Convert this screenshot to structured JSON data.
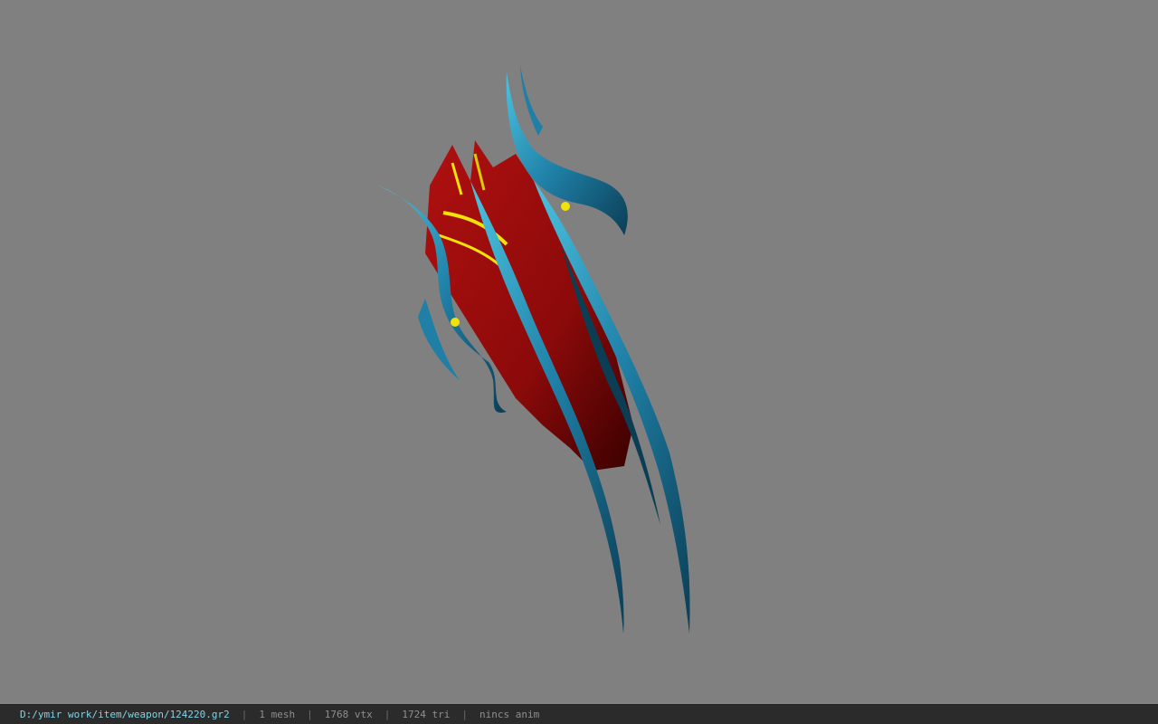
{
  "viewer": {
    "background_color": "#808080",
    "model": {
      "icon": "3d-model-weapon",
      "colors": {
        "blade_blue": "#1f7fa6",
        "blade_highlight": "#4cc3e0",
        "blade_dark": "#0b3e55",
        "core_red": "#8c0a0a",
        "core_dark": "#3a0000",
        "accent_yellow": "#f2e20c"
      }
    }
  },
  "status_bar": {
    "file_path": "D:/ymir work/item/weapon/124220.gr2",
    "separator": "|",
    "mesh_count": "1 mesh",
    "vertex_count": "1768 vtx",
    "triangle_count": "1724 tri",
    "anim_status": "nincs anim"
  }
}
